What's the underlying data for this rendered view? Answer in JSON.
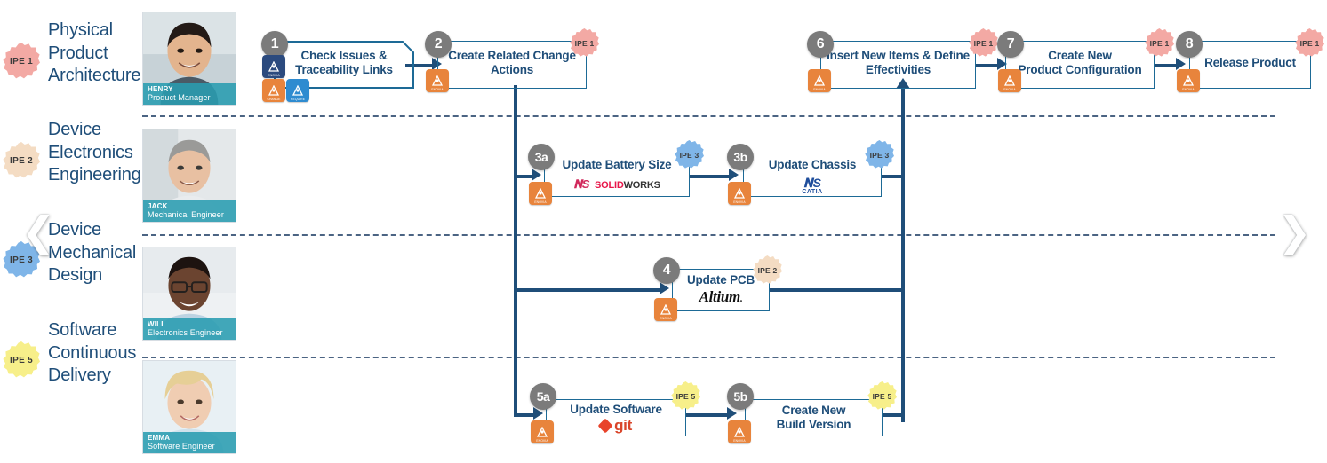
{
  "nav": {
    "prev_icon": "chevron-left-icon",
    "next_icon": "chevron-right-icon",
    "prev_glyph": "❮",
    "next_glyph": "❯"
  },
  "colors": {
    "lane_title": "#1f4e79",
    "flow_line": "#1d6a96",
    "flow_thick": "#1f4e79",
    "step_circle": "#7b7b7b",
    "app_orange": "#e8843c",
    "app_navy": "#2b4a7e",
    "app_blue": "#2e8bd0",
    "caption_teal": "#299cb0",
    "ipe1": "#f3a9a4",
    "ipe2": "#f4dcc3",
    "ipe3": "#7fb5e8",
    "ipe5": "#f7ef8a"
  },
  "lanes": [
    {
      "id": "physical-product-architecture",
      "badge": "IPE 1",
      "badge_color": "#f3a9a4",
      "title": "Physical\nProduct\nArchitecture",
      "person": {
        "name": "HENRY",
        "role": "Product Manager"
      }
    },
    {
      "id": "device-electronics-engineering",
      "badge": "IPE 2",
      "badge_color": "#f4dcc3",
      "title": "Device\nElectronics\nEngineering",
      "person": {
        "name": "JACK",
        "role": "Mechanical  Engineer"
      }
    },
    {
      "id": "device-mechanical-design",
      "badge": "IPE 3",
      "badge_color": "#7fb5e8",
      "title": "Device\nMechanical\nDesign",
      "person": {
        "name": "WILL",
        "role": "Electronics  Engineer"
      }
    },
    {
      "id": "software-continuous-delivery",
      "badge": "IPE 5",
      "badge_color": "#f7ef8a",
      "title": "Software\nContinuous\nDelivery",
      "person": {
        "name": "EMMA",
        "role": "Software  Engineer"
      }
    }
  ],
  "steps": [
    {
      "id": "step-1",
      "number": "1",
      "label": "Check Issues &\nTraceability Links",
      "lane": 0,
      "badge": null,
      "tool": null,
      "icons": [
        "navy-app-icon",
        "orange-app-icon",
        "blue-app-icon"
      ],
      "icon_labels": [
        "ENOVIA",
        "CHANGE",
        "REQUIRE"
      ]
    },
    {
      "id": "step-2",
      "number": "2",
      "label": "Create Related Change\nActions",
      "lane": 0,
      "badge": "IPE 1",
      "badge_color": "#f3a9a4",
      "tool": null,
      "icons": [
        "orange-app-icon"
      ],
      "icon_labels": [
        "ENOVIA"
      ]
    },
    {
      "id": "step-3a",
      "number": "3a",
      "label": "Update Battery Size",
      "lane": 1,
      "badge": "IPE 3",
      "badge_color": "#7fb5e8",
      "tool": "solidworks",
      "tool_text": "SOLIDWORKS",
      "icons": [
        "orange-app-icon"
      ],
      "icon_labels": [
        "ENOVIA"
      ]
    },
    {
      "id": "step-3b",
      "number": "3b",
      "label": "Update Chassis",
      "lane": 1,
      "badge": "IPE 3",
      "badge_color": "#7fb5e8",
      "tool": "catia",
      "tool_text": "CATIA",
      "icons": [
        "orange-app-icon"
      ],
      "icon_labels": [
        "ENOVIA"
      ]
    },
    {
      "id": "step-4",
      "number": "4",
      "label": "Update PCB",
      "lane": 2,
      "badge": "IPE 2",
      "badge_color": "#f4dcc3",
      "tool": "altium",
      "tool_text": "Altium",
      "icons": [
        "orange-app-icon"
      ],
      "icon_labels": [
        "ENOVIA"
      ]
    },
    {
      "id": "step-5a",
      "number": "5a",
      "label": "Update Software",
      "lane": 3,
      "badge": "IPE 5",
      "badge_color": "#f7ef8a",
      "tool": "git",
      "tool_text": "git",
      "icons": [
        "orange-app-icon"
      ],
      "icon_labels": [
        "ENOVIA"
      ]
    },
    {
      "id": "step-5b",
      "number": "5b",
      "label": "Create New\nBuild Version",
      "lane": 3,
      "badge": "IPE 5",
      "badge_color": "#f7ef8a",
      "tool": null,
      "icons": [
        "orange-app-icon"
      ],
      "icon_labels": [
        "ENOVIA"
      ]
    },
    {
      "id": "step-6",
      "number": "6",
      "label": "Insert New Items & Define\nEffectivities",
      "lane": 0,
      "badge": "IPE 1",
      "badge_color": "#f3a9a4",
      "tool": null,
      "icons": [
        "orange-app-icon"
      ],
      "icon_labels": [
        "ENOVIA"
      ]
    },
    {
      "id": "step-7",
      "number": "7",
      "label": "Create New\nProduct Configuration",
      "lane": 0,
      "badge": "IPE 1",
      "badge_color": "#f3a9a4",
      "tool": null,
      "icons": [
        "orange-app-icon"
      ],
      "icon_labels": [
        "ENOVIA"
      ]
    },
    {
      "id": "step-8",
      "number": "8",
      "label": "Release Product",
      "lane": 0,
      "badge": "IPE 1",
      "badge_color": "#f3a9a4",
      "tool": null,
      "icons": [
        "orange-app-icon"
      ],
      "icon_labels": [
        "ENOVIA"
      ]
    }
  ]
}
